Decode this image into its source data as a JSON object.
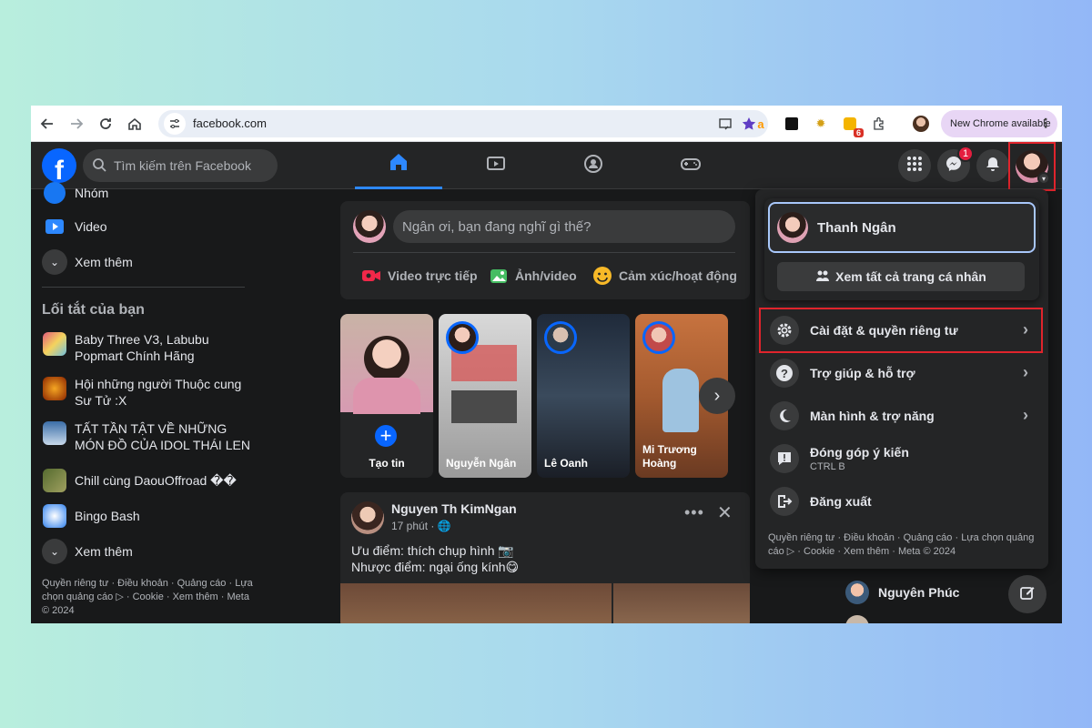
{
  "browser": {
    "url": "facebook.com",
    "new_chrome_label": "New Chrome available",
    "ext_badge": "6"
  },
  "header": {
    "search_placeholder": "Tìm kiếm trên Facebook",
    "messenger_badge": "1"
  },
  "sidebar": {
    "items": [
      {
        "label": "Nhóm",
        "icon": "groups-icon"
      },
      {
        "label": "Video",
        "icon": "video-icon"
      },
      {
        "label": "Xem thêm",
        "icon": "chevron-down-icon"
      }
    ],
    "shortcuts_title": "Lối tắt của bạn",
    "shortcuts": [
      {
        "label": "Baby Three V3, Labubu Popmart Chính Hãng"
      },
      {
        "label": "Hội những người Thuộc cung Sư Tử :X"
      },
      {
        "label": "TẤT TẦN TẬT VỀ NHỮNG MÓN ĐỒ CỦA IDOL THÁI LEN"
      },
      {
        "label": "Chill cùng DaouOffroad ��"
      },
      {
        "label": "Bingo Bash"
      }
    ],
    "see_more": "Xem thêm",
    "footer": "Quyền riêng tư · Điều khoản · Quảng cáo · Lựa chọn quảng cáo ▷ · Cookie · Xem thêm · Meta © 2024"
  },
  "composer": {
    "placeholder": "Ngân ơi, bạn đang nghĩ gì thế?",
    "actions": [
      "Video trực tiếp",
      "Ảnh/video",
      "Cảm xúc/hoạt động"
    ]
  },
  "stories": [
    {
      "name": "Tạo tin"
    },
    {
      "name": "Nguyễn Ngân"
    },
    {
      "name": "Lê Oanh"
    },
    {
      "name": "Mi Trương Hoàng"
    }
  ],
  "post": {
    "author": "Nguyen Th KimNgan",
    "time": "17 phút · 🌐",
    "line1": "Ưu điểm: thích chụp hình 📷",
    "line2": "Nhược điểm: ngại ống kính😋"
  },
  "dropdown": {
    "profile_name": "Thanh Ngân",
    "see_all": "Xem tất cả trang cá nhân",
    "items": [
      {
        "label": "Cài đặt & quyền riêng tư",
        "icon": "gear-icon"
      },
      {
        "label": "Trợ giúp & hỗ trợ",
        "icon": "help-icon"
      },
      {
        "label": "Màn hình & trợ năng",
        "icon": "moon-icon"
      },
      {
        "label": "Đóng góp ý kiến",
        "sub": "CTRL B",
        "icon": "feedback-icon"
      },
      {
        "label": "Đăng xuất",
        "icon": "logout-icon"
      }
    ],
    "footer": "Quyền riêng tư · Điều khoản · Quảng cáo · Lựa chọn quảng cáo ▷ · Cookie · Xem thêm · Meta © 2024"
  },
  "contacts": [
    {
      "name": "Nguyên Phúc"
    }
  ]
}
